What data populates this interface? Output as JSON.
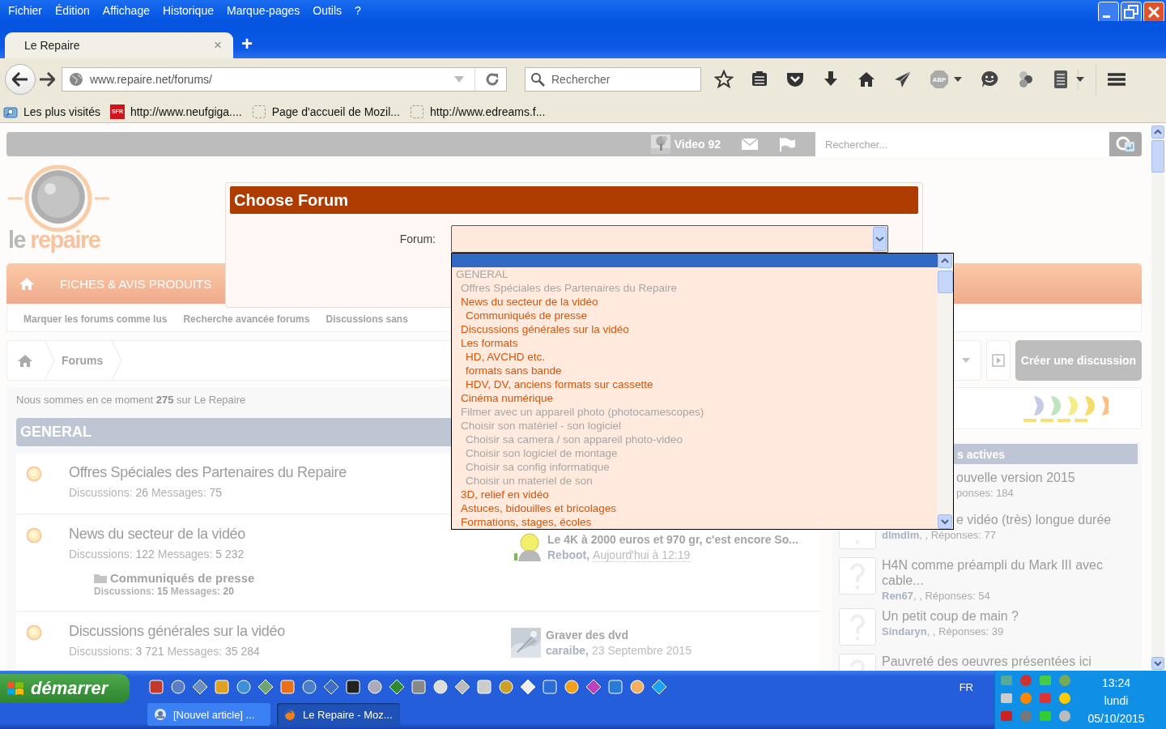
{
  "menu_bar": {
    "items": [
      "Fichier",
      "Édition",
      "Affichage",
      "Historique",
      "Marque-pages",
      "Outils",
      "?"
    ]
  },
  "tabs": [
    {
      "title": "Le Repaire",
      "selected": true,
      "close": "×"
    }
  ],
  "new_tab": "+",
  "address_bar": {
    "url": "www.repaire.net/forums/"
  },
  "search_bar": {
    "placeholder": "Rechercher"
  },
  "toolbar": {
    "addon_badge": "ABP"
  },
  "bookmarks": [
    {
      "kind": "folder",
      "label": "Les plus visités"
    },
    {
      "kind": "sfr",
      "icon_text": "SFR",
      "label": "http://www.neufgiga...."
    },
    {
      "kind": "blank",
      "label": "Page d'accueil de Mozil..."
    },
    {
      "kind": "blank",
      "label": "http://www.edreams.f..."
    }
  ],
  "page": {
    "top_bar": {
      "user": "Video 92",
      "search_placeholder": "Rechercher..."
    },
    "logo": {
      "prefix": "le",
      "name": "repaire"
    },
    "nav": {
      "label": "FICHES & AVIS PRODUITS"
    },
    "sub_nav": [
      "Marquer les forums comme lus",
      "Recherche avancée forums",
      "Discussions sans"
    ],
    "breadcrumb": [
      "Forums"
    ],
    "create_button": "Créer une discussion",
    "online": "Nous sommes en ce moment **275** sur Le Repaire",
    "category": "GENERAL",
    "forums": [
      {
        "title": "Offres Spéciales des Partenaires du Repaire",
        "discussions_label": "Discussions:",
        "discussions": "26",
        "messages_label": "Messages:",
        "messages": "75"
      },
      {
        "title": "News du secteur de la vidéo",
        "discussions_label": "Discussions:",
        "discussions": "122",
        "messages_label": "Messages:",
        "messages": "5 232",
        "subforums": [
          {
            "title": "Communiqués de presse",
            "discussions_label": "Discussions:",
            "discussions": "15",
            "messages_label": "Messages:",
            "messages": "20"
          }
        ],
        "last_post": {
          "kind": "smiley",
          "title": "Le 4K à 2000 euros et 970 gr, c'est encore So...",
          "user": "Reboot,",
          "date": "Aujourd'hui à 12:19"
        }
      },
      {
        "title": "Discussions générales sur la vidéo",
        "discussions_label": "Discussions:",
        "discussions": "3 721",
        "messages_label": "Messages:",
        "messages": "35 284",
        "last_post": {
          "title": "Graver des dvd",
          "user": "caraibe,",
          "date": "23 Septembre 2015"
        }
      }
    ],
    "sidebar": {
      "header": "s actives",
      "threads": [
        {
          "kind": "covered",
          "title": "ouvelle version 2015",
          "meta": "ponses: 184"
        },
        {
          "kind": "title-covered",
          "title": "e vidéo (très) longue durée",
          "user": "dlmdlm",
          "meta": ", , Réponses: 77"
        },
        {
          "kind": "full",
          "title": "H4N comme préampli du Mark III avec cable...",
          "user": "Ren67",
          "meta": ", , Réponses: 54"
        },
        {
          "kind": "full",
          "title": "Un petit coup de main ?",
          "user": "Sindaryn",
          "meta": ", , Réponses: 39"
        },
        {
          "kind": "full",
          "title": "Pauvreté des oeuvres présentées ici"
        }
      ]
    }
  },
  "modal": {
    "title": "Choose Forum",
    "field_label": "Forum:",
    "blank_option_selected": true,
    "options": [
      {
        "label": "GENERAL",
        "disabled": true,
        "children": [
          {
            "label": "Offres Spéciales des Partenaires du Repaire",
            "disabled": true
          },
          {
            "label": "News du secteur de la vidéo",
            "disabled": false,
            "children": [
              {
                "label": "Communiqués de presse",
                "disabled": false
              }
            ]
          },
          {
            "label": "Discussions générales sur la vidéo",
            "disabled": false
          },
          {
            "label": "Les formats",
            "disabled": false,
            "children": [
              {
                "label": "HD, AVCHD etc.",
                "disabled": false
              },
              {
                "label": "formats sans bande",
                "disabled": false
              },
              {
                "label": "HDV, DV, anciens formats sur cassette",
                "disabled": false
              }
            ]
          },
          {
            "label": "Cinéma numérique",
            "disabled": false
          },
          {
            "label": "Filmer avec un appareil photo (photocamescopes)",
            "disabled": true
          },
          {
            "label": "Choisir son matériel - son logiciel",
            "disabled": true,
            "children": [
              {
                "label": "Choisir sa camera / son appareil photo-video",
                "disabled": true
              },
              {
                "label": "Choisir son logiciel de montage",
                "disabled": true
              },
              {
                "label": "Choisir sa config informatique",
                "disabled": true
              },
              {
                "label": "Choisir un materiel de son",
                "disabled": true
              }
            ]
          },
          {
            "label": "3D, relief en vidéo",
            "disabled": false
          },
          {
            "label": "Astuces, bidouilles et bricolages",
            "disabled": false
          },
          {
            "label": "Formations, stages, écoles",
            "disabled": false
          }
        ]
      }
    ]
  },
  "taskbar": {
    "start": "démarrer",
    "tasks": [
      {
        "kind": "editor",
        "label": "[Nouvel article] ...",
        "selected": false
      },
      {
        "kind": "browser",
        "label": "Le Repaire - Moz...",
        "selected": true
      }
    ],
    "language": "FR",
    "clock": {
      "time": "13:24",
      "day": "lundi",
      "date": "05/10/2015"
    }
  }
}
